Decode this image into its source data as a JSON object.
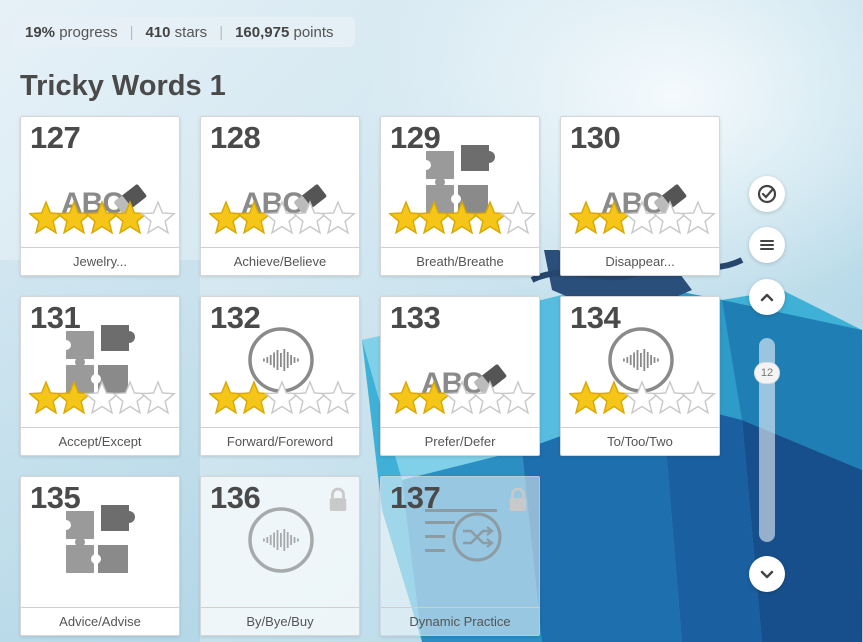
{
  "stats": {
    "progress_value": "19%",
    "progress_label": "progress",
    "stars_value": "410",
    "stars_label": "stars",
    "points_value": "160,975",
    "points_label": "points"
  },
  "title": "Tricky Words 1",
  "lessons": [
    {
      "number": "127",
      "label": "Jewelry...",
      "icon": "abc-eraser-icon",
      "stars": 4,
      "locked": false
    },
    {
      "number": "128",
      "label": "Achieve/Believe",
      "icon": "abc-eraser-icon",
      "stars": 2,
      "locked": false
    },
    {
      "number": "129",
      "label": "Breath/Breathe",
      "icon": "puzzle-icon",
      "stars": 4,
      "locked": false
    },
    {
      "number": "130",
      "label": "Disappear...",
      "icon": "abc-eraser-icon",
      "stars": 2,
      "locked": false
    },
    {
      "number": "131",
      "label": "Accept/Except",
      "icon": "puzzle-icon",
      "stars": 2,
      "locked": false
    },
    {
      "number": "132",
      "label": "Forward/Foreword",
      "icon": "audio-wave-icon",
      "stars": 2,
      "locked": false
    },
    {
      "number": "133",
      "label": "Prefer/Defer",
      "icon": "abc-eraser-icon",
      "stars": 2,
      "locked": false
    },
    {
      "number": "134",
      "label": "To/Too/Two",
      "icon": "audio-wave-icon",
      "stars": 2,
      "locked": false
    },
    {
      "number": "135",
      "label": "Advice/Advise",
      "icon": "puzzle-icon",
      "stars": 0,
      "locked": false
    },
    {
      "number": "136",
      "label": "By/Bye/Buy",
      "icon": "audio-wave-icon",
      "stars": 0,
      "locked": true
    },
    {
      "number": "137",
      "label": "Dynamic Practice",
      "icon": "shuffle-list-icon",
      "stars": 0,
      "locked": true
    }
  ],
  "sidebar": {
    "buttons": [
      {
        "name": "check-circle-icon"
      },
      {
        "name": "menu-icon"
      },
      {
        "name": "chevron-up-icon"
      },
      {
        "name": "chevron-down-icon"
      }
    ],
    "scroll_badge": "12"
  },
  "colors": {
    "star_fill": "#f5c518",
    "star_empty": "#ffffff",
    "icon_gray": "#8a8a8a",
    "text_dark": "#4a4a4a"
  }
}
